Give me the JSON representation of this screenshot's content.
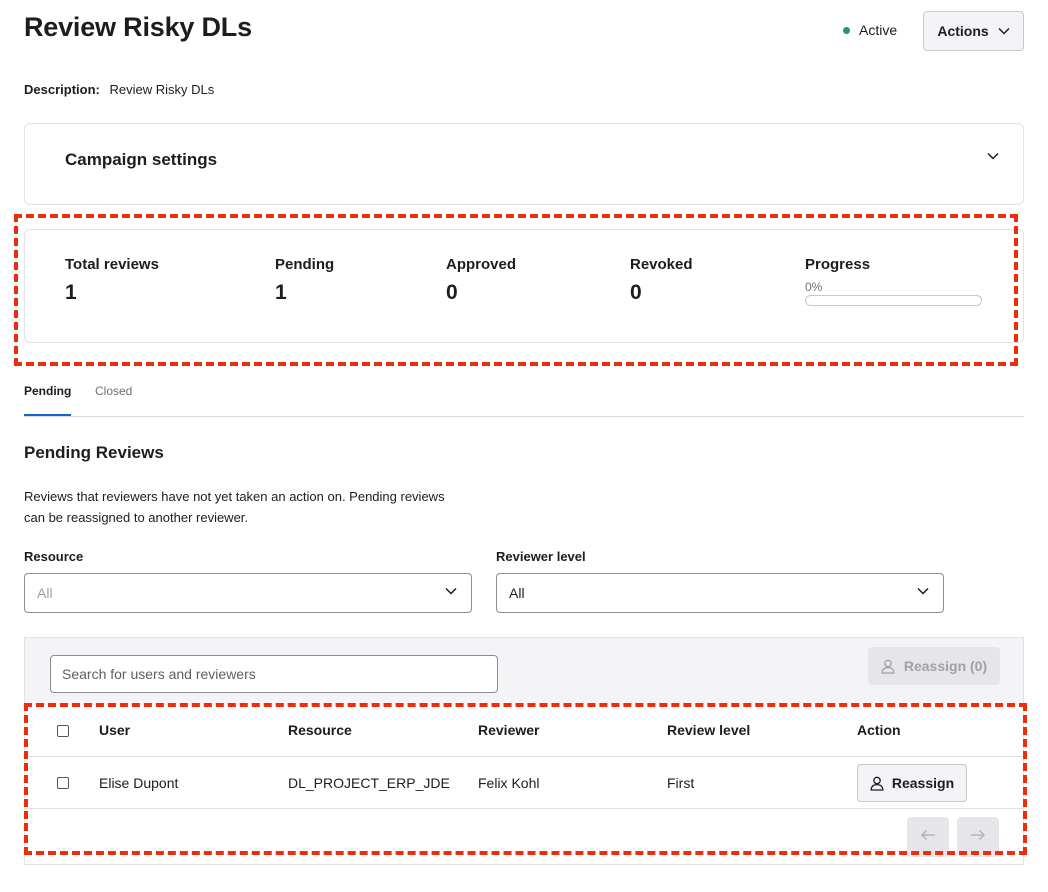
{
  "header": {
    "title": "Review Risky DLs",
    "status": "Active",
    "actions_label": "Actions"
  },
  "description": {
    "label": "Description:",
    "value": "Review Risky DLs"
  },
  "campaign_settings": {
    "title": "Campaign settings"
  },
  "stats": {
    "total_reviews": {
      "label": "Total reviews",
      "value": "1"
    },
    "pending": {
      "label": "Pending",
      "value": "1"
    },
    "approved": {
      "label": "Approved",
      "value": "0"
    },
    "revoked": {
      "label": "Revoked",
      "value": "0"
    },
    "progress": {
      "label": "Progress",
      "percent_text": "0%",
      "fraction": 0
    }
  },
  "tabs": [
    {
      "label": "Pending",
      "active": true
    },
    {
      "label": "Closed",
      "active": false
    }
  ],
  "section": {
    "title": "Pending Reviews",
    "description": "Reviews that reviewers have not yet taken an action on. Pending reviews can be reassigned to another reviewer."
  },
  "filters": {
    "resource": {
      "label": "Resource",
      "value": "All"
    },
    "reviewer_level": {
      "label": "Reviewer level",
      "value": "All"
    }
  },
  "table": {
    "search_placeholder": "Search for users and reviewers",
    "reassign_all_label": "Reassign (0)",
    "columns": [
      "User",
      "Resource",
      "Reviewer",
      "Review level",
      "Action"
    ],
    "rows": [
      {
        "user": "Elise Dupont",
        "resource": "DL_PROJECT_ERP_JDE",
        "reviewer": "Felix Kohl",
        "review_level": "First",
        "action_label": "Reassign"
      }
    ]
  },
  "colors": {
    "status_active": "#1f9c62",
    "accent": "#1662dd",
    "highlight_dash": "#ec2d0e"
  },
  "icons": {
    "status": "status-dot",
    "dropdown": "chevron-down-icon",
    "reassign": "user-icon",
    "pager_prev": "arrow-left-icon",
    "pager_next": "arrow-right-icon"
  }
}
